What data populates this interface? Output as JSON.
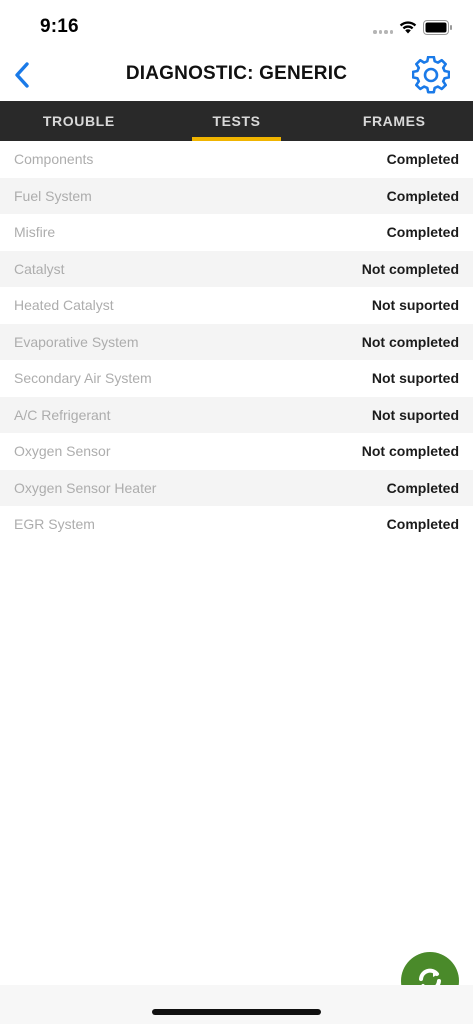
{
  "status_bar": {
    "time": "9:16"
  },
  "nav": {
    "title": "DIAGNOSTIC: GENERIC",
    "back_icon": "chevron-left-icon",
    "settings_icon": "gear-icon"
  },
  "tabs": [
    {
      "label": "TROUBLE",
      "active": false
    },
    {
      "label": "TESTS",
      "active": true
    },
    {
      "label": "FRAMES",
      "active": false
    }
  ],
  "tests": [
    {
      "name": "Components",
      "status": "Completed"
    },
    {
      "name": "Fuel System",
      "status": "Completed"
    },
    {
      "name": "Misfire",
      "status": "Completed"
    },
    {
      "name": "Catalyst",
      "status": "Not completed"
    },
    {
      "name": "Heated Catalyst",
      "status": "Not suported"
    },
    {
      "name": "Evaporative System",
      "status": "Not completed"
    },
    {
      "name": "Secondary Air System",
      "status": "Not suported"
    },
    {
      "name": "A/C Refrigerant",
      "status": "Not suported"
    },
    {
      "name": "Oxygen Sensor",
      "status": "Not completed"
    },
    {
      "name": "Oxygen Sensor Heater",
      "status": "Completed"
    },
    {
      "name": "EGR System",
      "status": "Completed"
    }
  ],
  "fab": {
    "icon": "refresh-icon"
  },
  "colors": {
    "accent_blue": "#1a7ae8",
    "tab_bar": "#292929",
    "tab_indicator": "#f0b400",
    "fab_green": "#4a8a2a"
  }
}
